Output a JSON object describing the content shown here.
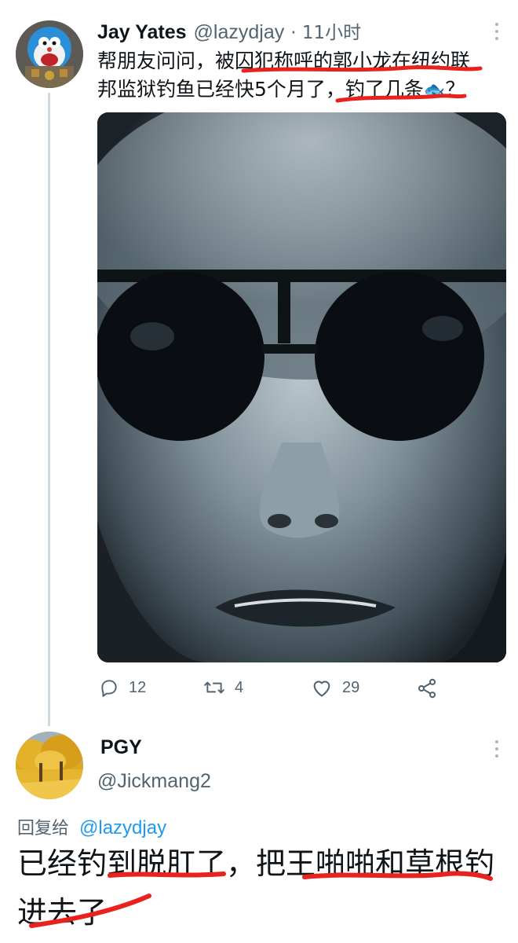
{
  "tweet": {
    "author_name": "Jay Yates",
    "author_handle": "@lazydjay",
    "timestamp": "· 11小时",
    "text_line1": "帮朋友问问，被囚犯称呼的郭小龙在纽约联",
    "text_line2": "邦监狱钓鱼已经快5个月了，钓了几条",
    "text_line2_emoji": "🐟",
    "text_line2_end": "？",
    "actions": {
      "reply_count": "12",
      "retweet_count": "4",
      "like_count": "29"
    }
  },
  "reply": {
    "author_name": "PGY",
    "author_handle": "@Jickmang2",
    "reply_to_label": "回复给",
    "reply_to_handle": "@lazydjay",
    "text_line1": "已经钓到脱肛了，把王啪啪和草根钓",
    "text_line2": "进去了"
  },
  "colors": {
    "link_blue": "#1d9bf0",
    "muted": "#536471",
    "thread_line": "#cfd9de",
    "annotation_red": "#e8231f"
  }
}
